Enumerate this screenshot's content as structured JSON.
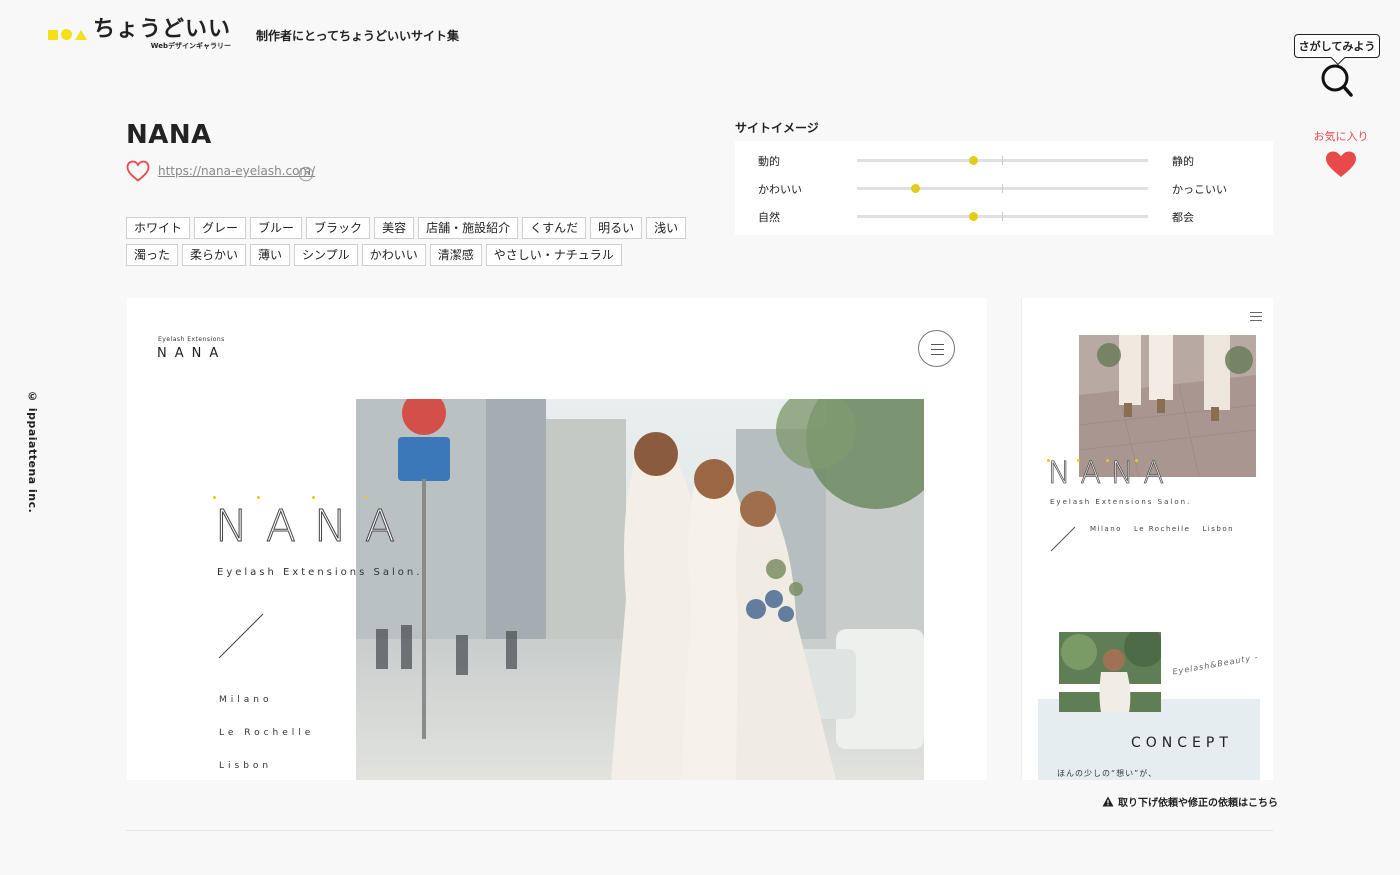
{
  "header": {
    "logo_text": "ちょうどいい",
    "logo_sub": "Webデザインギャラリー",
    "tagline": "制作者にとってちょうどいいサイト集",
    "search_bubble": "さがしてみよう",
    "favorites_label": "お気に入り"
  },
  "side": {
    "copyright": "© ippaiattena inc."
  },
  "site": {
    "title": "NANA",
    "url": "https://nana-eyelash.com/",
    "tags": [
      "ホワイト",
      "グレー",
      "ブルー",
      "ブラック",
      "美容",
      "店舗・施設紹介",
      "くすんだ",
      "明るい",
      "浅い",
      "濁った",
      "柔らかい",
      "薄い",
      "シンプル",
      "かわいい",
      "清潔感",
      "やさしい・ナチュラル"
    ]
  },
  "site_image": {
    "title": "サイトイメージ",
    "rows": [
      {
        "left": "動的",
        "right": "静的",
        "value": 0.4
      },
      {
        "left": "かわいい",
        "right": "かっこいい",
        "value": 0.2
      },
      {
        "left": "自然",
        "right": "都会",
        "value": 0.4
      }
    ]
  },
  "preview_pc": {
    "brand_small": "Eyelash Extensions",
    "brand": "NANA",
    "hero": "NANA",
    "hero_sub": "Eyelash Extensions Salon.",
    "cities": [
      "Milano",
      "Le Rochelle",
      "Lisbon"
    ]
  },
  "preview_sp": {
    "hero": "NANA",
    "hero_sub": "Eyelash Extensions Salon.",
    "cities": [
      "Milano",
      "Le Rochelle",
      "Lisbon"
    ],
    "script": "Eyelash&Beauty -",
    "concept": "CONCEPT",
    "concept_text": "ほんの少しの“想い”が、"
  },
  "footer": {
    "report_link": "取り下げ依頼や修正の依頼はこちら"
  },
  "colors": {
    "accent_yellow": "#f2e01a",
    "heart_red": "#e84a4a",
    "dot_yellow": "#e3cc15"
  }
}
